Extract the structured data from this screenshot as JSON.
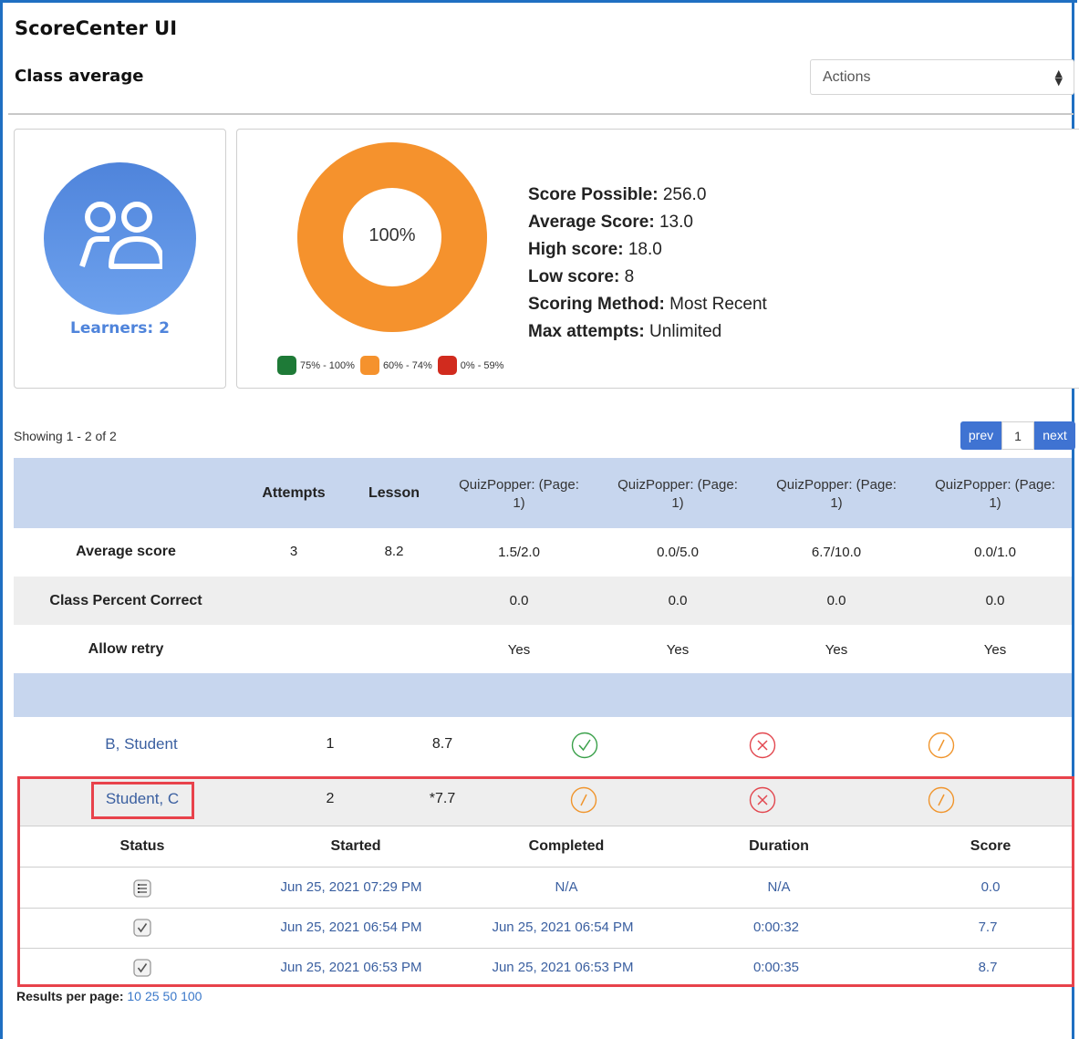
{
  "app": {
    "title": "ScoreCenter UI"
  },
  "header": {
    "page_title": "Class average",
    "actions_label": "Actions"
  },
  "learners": {
    "label": "Learners: 2"
  },
  "donut": {
    "percent_label": "100%",
    "fill_fraction": 1.0,
    "fill_color": "#f5922d",
    "legend": [
      {
        "label": "75% - 100%",
        "color": "#1e7a37"
      },
      {
        "label": "60% - 74%",
        "color": "#f5922d"
      },
      {
        "label": "0% - 59%",
        "color": "#d12b1e"
      }
    ]
  },
  "stats": [
    {
      "label": "Score Possible:",
      "value": "256.0"
    },
    {
      "label": "Average Score:",
      "value": "13.0"
    },
    {
      "label": "High score:",
      "value": "18.0"
    },
    {
      "label": "Low score:",
      "value": "8"
    },
    {
      "label": "Scoring Method:",
      "value": "Most Recent"
    },
    {
      "label": "Max attempts:",
      "value": "Unlimited"
    }
  ],
  "pagination": {
    "showing": "Showing 1 - 2 of 2",
    "prev": "prev",
    "page": "1",
    "next": "next"
  },
  "table": {
    "columns": [
      "Attempts",
      "Lesson",
      "QuizPopper: (Page: 1)",
      "QuizPopper: (Page: 1)",
      "QuizPopper: (Page: 1)",
      "QuizPopper: (Page: 1)"
    ],
    "quiz_line1": "QuizPopper: (Page:",
    "quiz_line2": "1)",
    "summary_rows": [
      {
        "label": "Average score",
        "attempts": "3",
        "lesson": "8.2",
        "q": [
          "1.5/2.0",
          "0.0/5.0",
          "6.7/10.0",
          "0.0/1.0"
        ]
      },
      {
        "label": "Class Percent Correct",
        "attempts": "",
        "lesson": "",
        "q": [
          "0.0",
          "0.0",
          "0.0",
          "0.0"
        ]
      },
      {
        "label": "Allow retry",
        "attempts": "",
        "lesson": "",
        "q": [
          "Yes",
          "Yes",
          "Yes",
          "Yes"
        ]
      }
    ],
    "students": [
      {
        "name": "B, Student",
        "attempts": "1",
        "lesson": "8.7",
        "status": [
          "correct",
          "incorrect",
          "partial"
        ]
      },
      {
        "name": "Student, C",
        "attempts": "2",
        "lesson": "*7.7",
        "status": [
          "partial",
          "incorrect",
          "partial"
        ]
      }
    ]
  },
  "attempt_details": {
    "headers": [
      "Status",
      "Started",
      "Completed",
      "Duration",
      "Score"
    ],
    "rows": [
      {
        "status_icon": "in-progress-icon",
        "started": "Jun 25, 2021 07:29 PM",
        "completed": "N/A",
        "duration": "N/A",
        "score": "0.0"
      },
      {
        "status_icon": "completed-icon",
        "started": "Jun 25, 2021 06:54 PM",
        "completed": "Jun 25, 2021 06:54 PM",
        "duration": "0:00:32",
        "score": "7.7"
      },
      {
        "status_icon": "completed-icon",
        "started": "Jun 25, 2021 06:53 PM",
        "completed": "Jun 25, 2021 06:53 PM",
        "duration": "0:00:35",
        "score": "8.7"
      }
    ]
  },
  "footer": {
    "results_label": "Results per page:",
    "options": [
      "10",
      "25",
      "50",
      "100"
    ]
  },
  "colors": {
    "accent": "#3f73d2",
    "header_band": "#c7d6ee",
    "highlight": "#e8424b",
    "correct": "#3aa04a",
    "incorrect": "#e2474f",
    "partial": "#f0952d"
  }
}
